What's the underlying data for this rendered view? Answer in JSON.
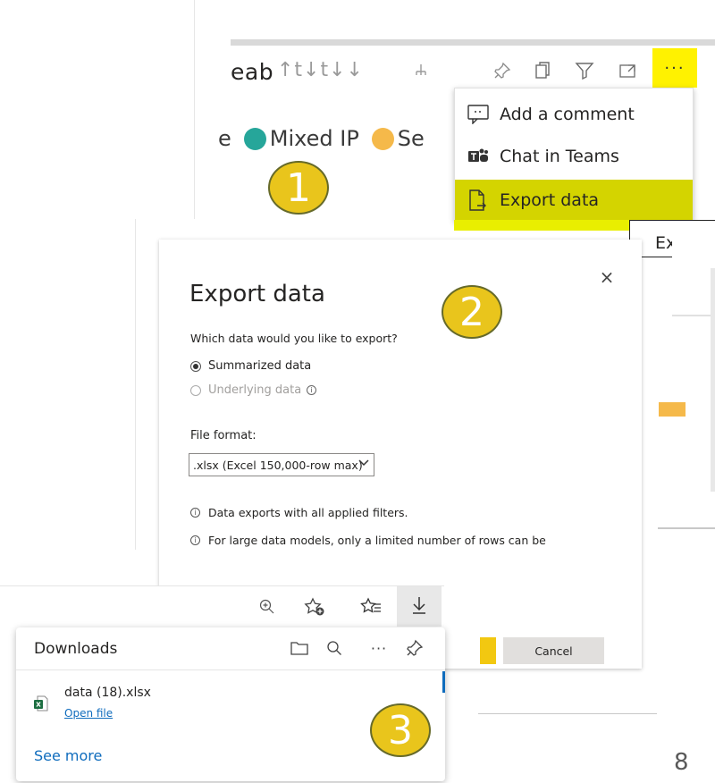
{
  "panel1": {
    "title_fragment": "eab",
    "sort_glyphs": "↑t↓t↓↓",
    "more_label": "···",
    "legend": [
      {
        "prefix": "e",
        "label": "",
        "color": ""
      },
      {
        "label": "Mixed IP",
        "color": "#26a69a"
      },
      {
        "label": "Se",
        "color": "#f5b94a"
      }
    ],
    "badge": "1",
    "menu": [
      {
        "label": "Add a comment",
        "icon": "comment-icon"
      },
      {
        "label": "Chat in Teams",
        "icon": "teams-icon"
      },
      {
        "label": "Export data",
        "icon": "export-file-icon",
        "highlighted": true
      }
    ],
    "tooltip": "Export d"
  },
  "panel2": {
    "title": "Export data",
    "close": "×",
    "badge": "2",
    "question": "Which data would you like to export?",
    "options": [
      {
        "label": "Summarized data",
        "selected": true,
        "enabled": true
      },
      {
        "label": "Underlying data",
        "selected": false,
        "enabled": false
      }
    ],
    "info_glyph": "i",
    "file_format_label": "File format:",
    "file_format_value": ".xlsx (Excel 150,000-row max)",
    "notes": [
      "Data exports with all applied filters.",
      "For large data models, only a limited number of rows can be"
    ],
    "cancel_label": "Cancel",
    "export_color": "#f2c811"
  },
  "panel3": {
    "downloads_title": "Downloads",
    "file_name": "data (18).xlsx",
    "open_file": "Open file",
    "see_more": "See more",
    "badge": "3",
    "more_label": "···"
  },
  "page_number": "8",
  "colors": {
    "highlight_yellow": "#fff200",
    "badge_fill": "#e9c51c",
    "link_blue": "#0f6cbd"
  }
}
